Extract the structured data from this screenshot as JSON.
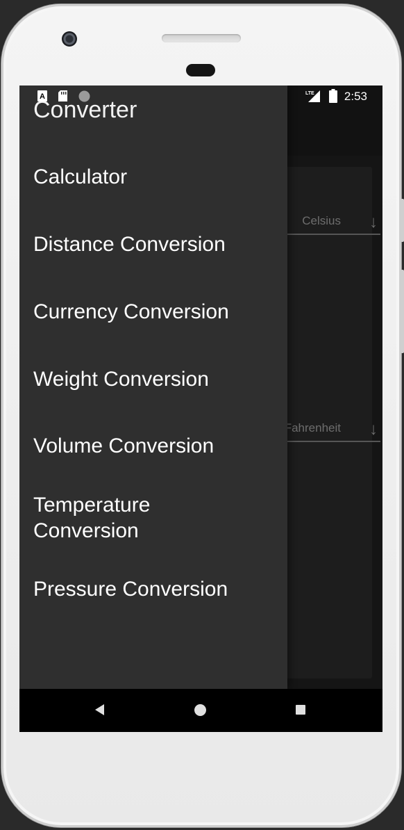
{
  "status_bar": {
    "time": "2:53",
    "icons": [
      "a-text-icon",
      "sd-card-icon",
      "circle-icon",
      "lte-signal-icon",
      "battery-icon"
    ],
    "network_label": "LTE"
  },
  "background_app": {
    "from_unit": "Celsius",
    "to_unit": "Fahrenheit"
  },
  "drawer": {
    "title": "Converter",
    "items": [
      {
        "label": "Calculator"
      },
      {
        "label": "Distance Conversion"
      },
      {
        "label": "Currency Conversion"
      },
      {
        "label": "Weight Conversion"
      },
      {
        "label": "Volume Conversion"
      },
      {
        "label": "Temperature Conversion"
      },
      {
        "label": "Pressure Conversion"
      }
    ]
  },
  "nav_bar": {
    "icons": [
      "back-icon",
      "home-icon",
      "recents-icon"
    ]
  },
  "colors": {
    "drawer_bg": "#2f2f2f",
    "screen_bg": "#1c1c1c",
    "text": "#ffffff"
  }
}
